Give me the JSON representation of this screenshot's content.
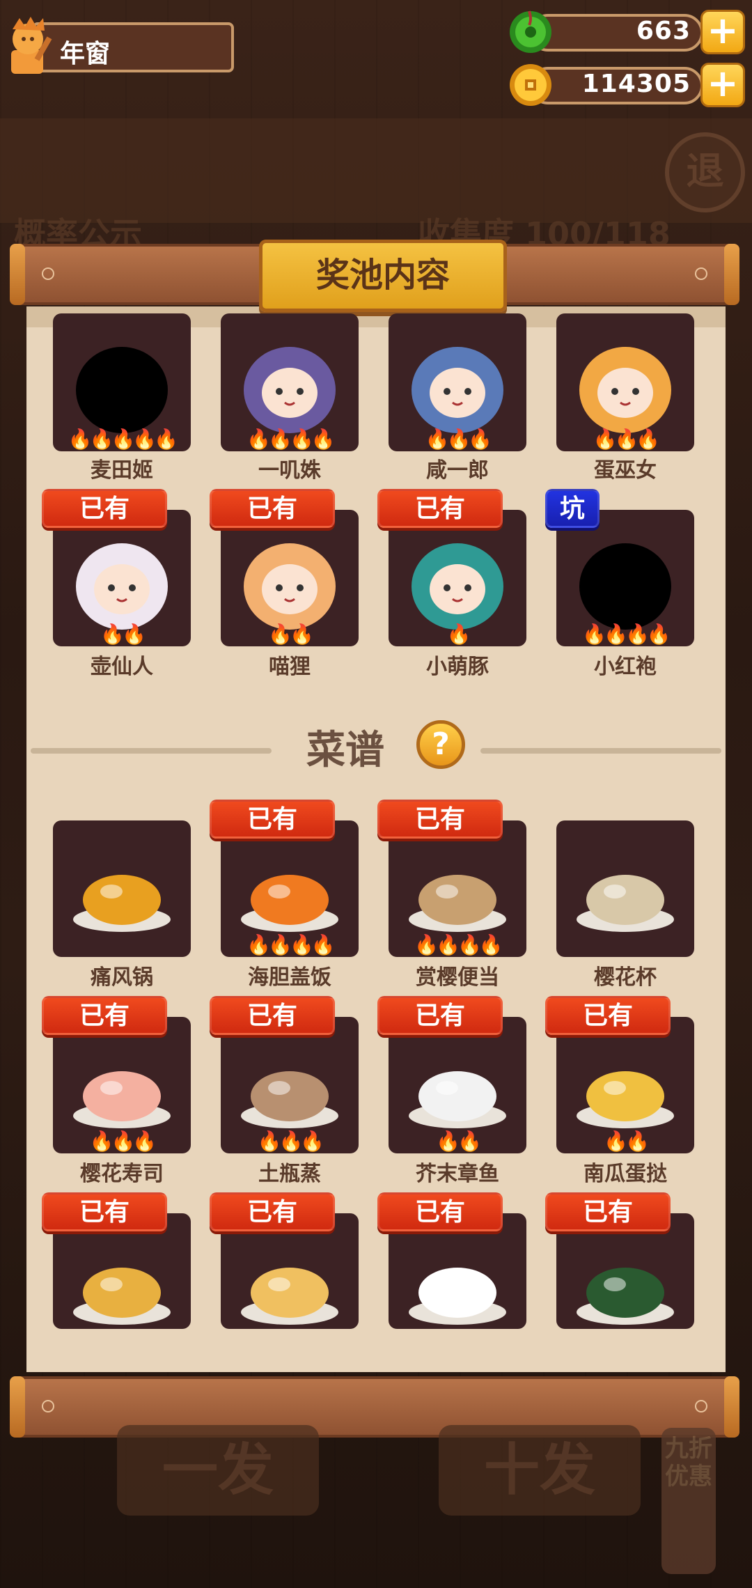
{
  "player": {
    "name": "年窗"
  },
  "currencies": {
    "jade": {
      "value": "663",
      "icon": "jade-coin-icon",
      "plus": "+"
    },
    "coin": {
      "value": "114305",
      "icon": "gold-coin-icon",
      "plus": "+"
    }
  },
  "panel": {
    "title": "奖池内容"
  },
  "badges": {
    "owned": "已有",
    "pit": "坑"
  },
  "characters": [
    {
      "name": "麦田姬",
      "fires": 5,
      "owned": false,
      "silhouette": true,
      "badge": ""
    },
    {
      "name": "一叽姝",
      "fires": 4,
      "owned": false,
      "silhouette": false,
      "badge": ""
    },
    {
      "name": "咸一郎",
      "fires": 3,
      "owned": false,
      "silhouette": false,
      "badge": ""
    },
    {
      "name": "蛋巫女",
      "fires": 3,
      "owned": false,
      "silhouette": false,
      "badge": ""
    },
    {
      "name": "壶仙人",
      "fires": 2,
      "owned": true,
      "silhouette": false,
      "badge": "owned"
    },
    {
      "name": "喵狸",
      "fires": 2,
      "owned": true,
      "silhouette": false,
      "badge": "owned"
    },
    {
      "name": "小萌豚",
      "fires": 1,
      "owned": true,
      "silhouette": false,
      "badge": "owned"
    },
    {
      "name": "小红袍",
      "fires": 4,
      "owned": false,
      "silhouette": true,
      "badge": "pit"
    }
  ],
  "recipes_section": {
    "title": "菜谱",
    "help": "?"
  },
  "recipes": [
    {
      "name": "痛风锅",
      "fires": 0,
      "owned": false
    },
    {
      "name": "海胆盖饭",
      "fires": 4,
      "owned": true
    },
    {
      "name": "赏樱便当",
      "fires": 4,
      "owned": true
    },
    {
      "name": "樱花杯",
      "fires": 0,
      "owned": false
    },
    {
      "name": "樱花寿司",
      "fires": 3,
      "owned": true
    },
    {
      "name": "土瓶蒸",
      "fires": 3,
      "owned": true
    },
    {
      "name": "芥末章鱼",
      "fires": 2,
      "owned": true
    },
    {
      "name": "南瓜蛋挞",
      "fires": 2,
      "owned": true
    },
    {
      "name": "",
      "fires": 0,
      "owned": true
    },
    {
      "name": "",
      "fires": 0,
      "owned": true
    },
    {
      "name": "",
      "fires": 0,
      "owned": true
    },
    {
      "name": "",
      "fires": 0,
      "owned": true
    }
  ],
  "background": {
    "exit": "退",
    "left_header": "概率公示",
    "right_header": "收集度 100/118",
    "btn_one": "一发",
    "btn_ten": "十发",
    "discount": "九折优惠"
  },
  "colors": {
    "badge_red": "#e23a16",
    "badge_blue": "#1c28c8",
    "paper": "#e8d5bb",
    "card": "#3c2224"
  }
}
